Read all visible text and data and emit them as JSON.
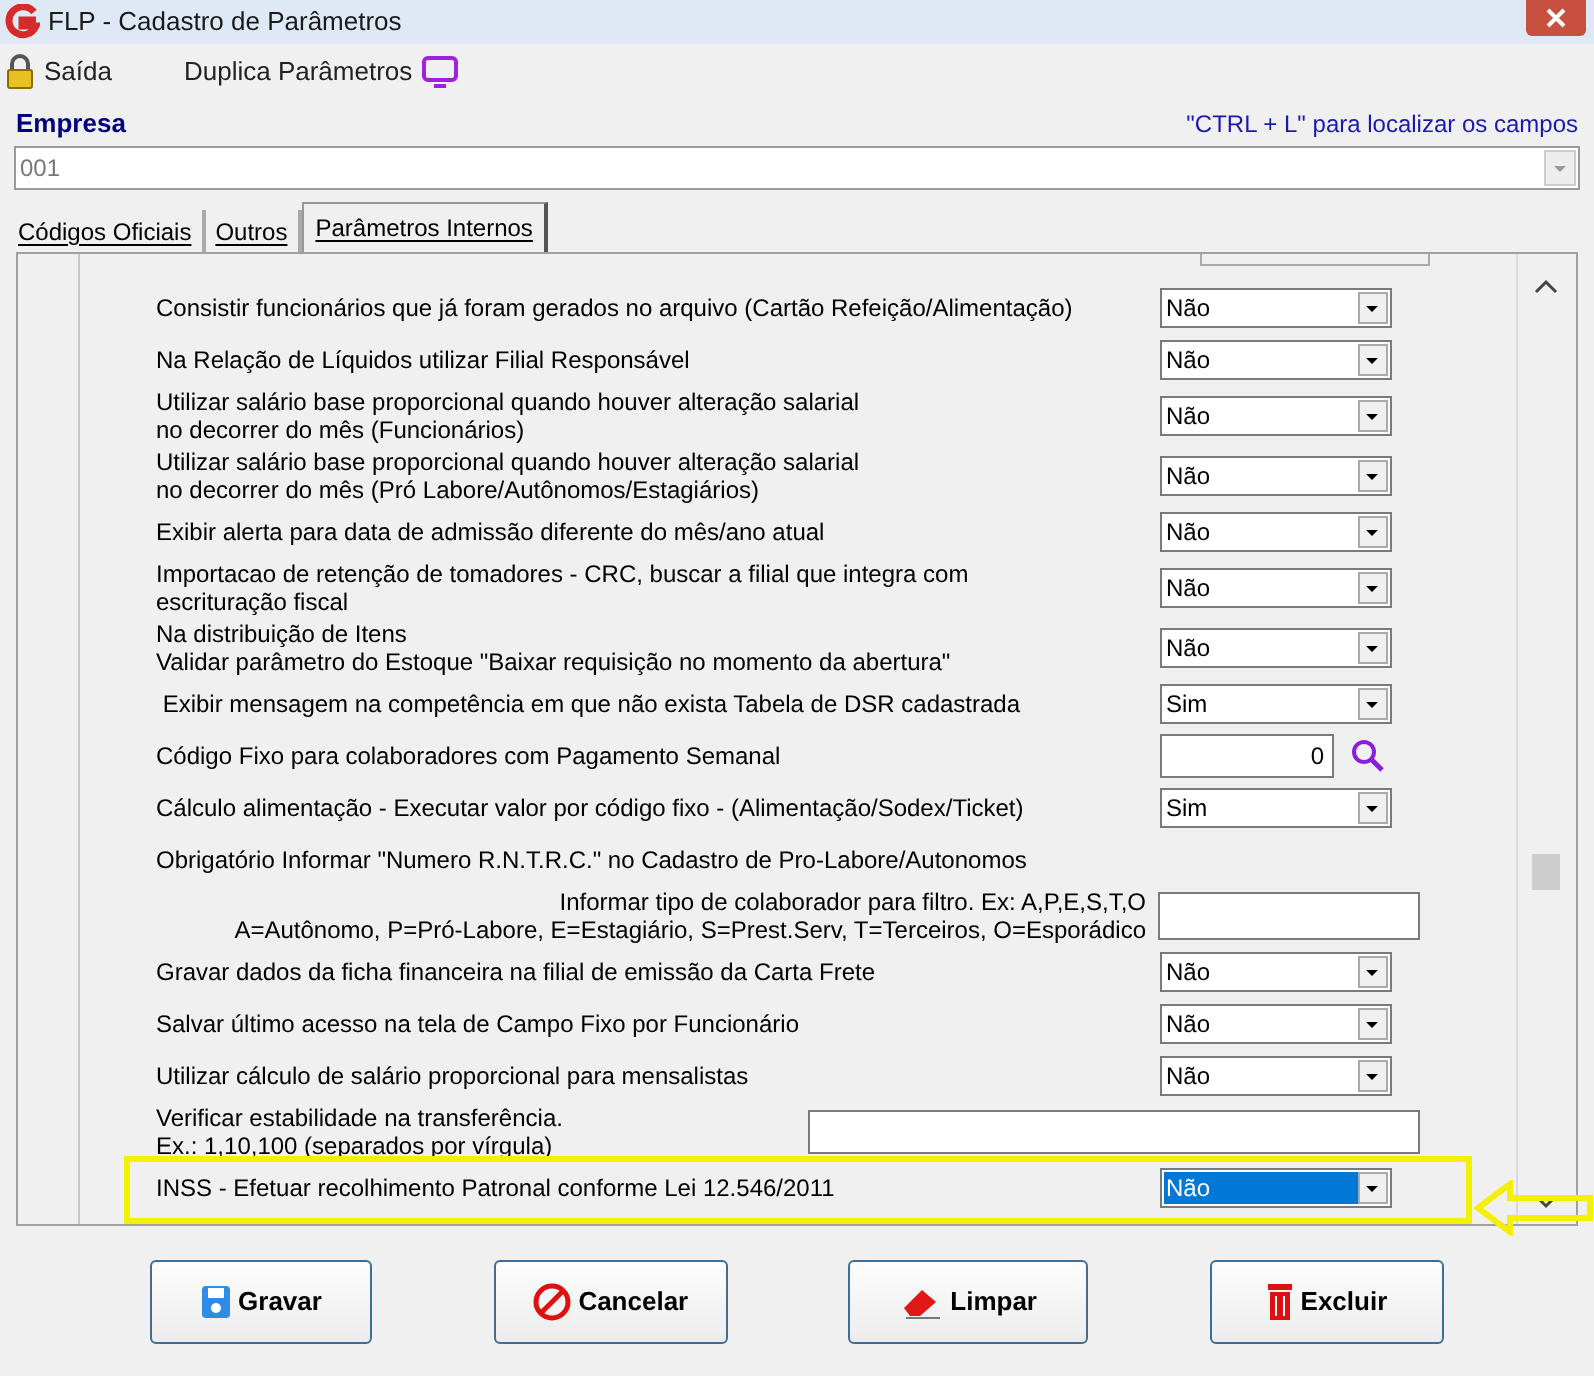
{
  "window": {
    "title": "FLP - Cadastro de Parâmetros"
  },
  "toolbar": [
    {
      "label": "Saída",
      "kind": "lock"
    },
    {
      "label": "Duplica Parâmetros",
      "kind": "monitor"
    }
  ],
  "empresa": {
    "label": "Empresa",
    "hint": "\"CTRL + L\" para localizar os campos",
    "value": "001"
  },
  "tabs": [
    {
      "label": "Códigos Oficiais",
      "selected": false
    },
    {
      "label": "Outros",
      "selected": false
    },
    {
      "label": "Parâmetros Internos",
      "selected": true
    }
  ],
  "rows": [
    {
      "kind": "select",
      "lines": [
        "Consistir funcionários que já foram gerados no arquivo (Cartão Refeição/Alimentação)"
      ],
      "value": "Não",
      "highlighted": false
    },
    {
      "kind": "select",
      "lines": [
        "Na Relação de Líquidos utilizar Filial Responsável"
      ],
      "value": "Não",
      "highlighted": false
    },
    {
      "kind": "select",
      "lines": [
        "Utilizar salário base proporcional quando houver alteração salarial",
        "no decorrer do mês (Funcionários)"
      ],
      "value": "Não",
      "highlighted": false
    },
    {
      "kind": "select",
      "lines": [
        "Utilizar salário base proporcional quando houver alteração salarial",
        "no decorrer do mês (Pró Labore/Autônomos/Estagiários)"
      ],
      "value": "Não",
      "highlighted": false
    },
    {
      "kind": "select",
      "lines": [
        "Exibir alerta para data de admissão diferente do mês/ano atual"
      ],
      "value": "Não",
      "highlighted": false
    },
    {
      "kind": "select",
      "lines": [
        "Importacao de retenção de tomadores - CRC, buscar a filial que integra com",
        "escrituração fiscal"
      ],
      "value": "Não",
      "highlighted": false
    },
    {
      "kind": "select",
      "lines": [
        "Na distribuição de Itens",
        "Validar parâmetro do Estoque \"Baixar requisição no momento da abertura\""
      ],
      "value": "Não",
      "highlighted": false
    },
    {
      "kind": "select",
      "lines": [
        " Exibir mensagem na competência em que não exista Tabela de DSR cadastrada"
      ],
      "value": "Sim",
      "highlighted": false
    },
    {
      "kind": "lookup",
      "lines": [
        "Código Fixo para colaboradores com Pagamento Semanal"
      ],
      "value": "0",
      "highlighted": false
    },
    {
      "kind": "select",
      "lines": [
        "Cálculo alimentação - Executar valor por código fixo - (Alimentação/Sodex/Ticket)"
      ],
      "value": "Sim",
      "highlighted": false
    },
    {
      "kind": "label",
      "lines": [
        "Obrigatório Informar \"Numero R.N.T.R.C.\" no Cadastro de Pro-Labore/Autonomos"
      ],
      "highlighted": false
    },
    {
      "kind": "text",
      "lines": [
        "Informar tipo de colaborador para filtro. Ex: A,P,E,S,T,O",
        "A=Autônomo, P=Pró-Labore, E=Estagiário, S=Prest.Serv, T=Terceiros, O=Esporádico"
      ],
      "highlighted": false
    },
    {
      "kind": "select",
      "lines": [
        "Gravar dados da ficha financeira na filial de emissão da Carta Frete"
      ],
      "value": "Não",
      "highlighted": false
    },
    {
      "kind": "select",
      "lines": [
        "Salvar último acesso na tela de Campo Fixo por Funcionário"
      ],
      "value": "Não",
      "highlighted": false
    },
    {
      "kind": "select",
      "lines": [
        "Utilizar cálculo de salário proporcional para mensalistas"
      ],
      "value": "Não",
      "highlighted": false
    },
    {
      "kind": "widetext",
      "lines": [
        "Verificar estabilidade na transferência.",
        "Ex.: 1,10,100 (separados por vírgula)"
      ],
      "highlighted": false
    },
    {
      "kind": "select",
      "lines": [
        "INSS - Efetuar recolhimento Patronal conforme Lei 12.546/2011"
      ],
      "value": "Não",
      "highlighted": true
    }
  ],
  "buttons": [
    {
      "label": "Gravar",
      "kind": "save"
    },
    {
      "label": "Cancelar",
      "kind": "cancel"
    },
    {
      "label": "Limpar",
      "kind": "clear"
    },
    {
      "label": "Excluir",
      "kind": "delete"
    }
  ]
}
